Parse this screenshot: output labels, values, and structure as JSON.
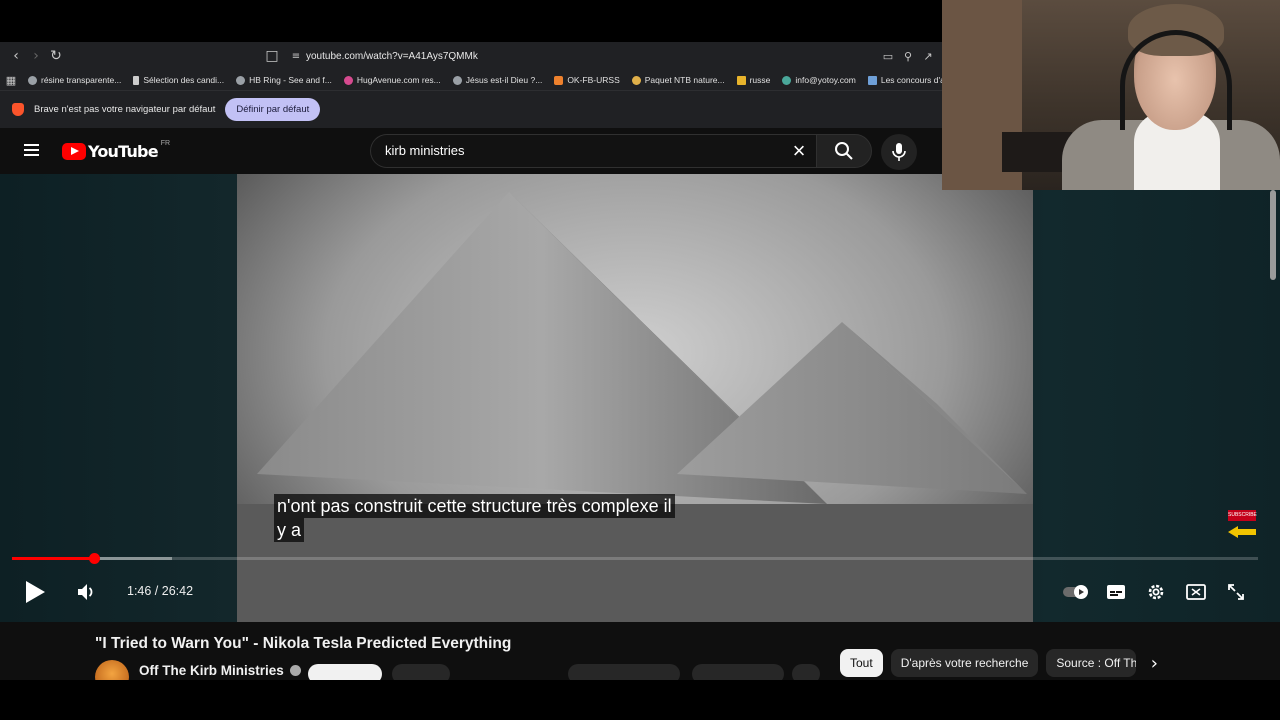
{
  "browser": {
    "url": "youtube.com/watch?v=A41Ays7QMMk",
    "bookmarks": [
      {
        "label": "résine transparente..."
      },
      {
        "label": "Sélection des candi..."
      },
      {
        "label": "HB Ring - See and f..."
      },
      {
        "label": "HugAvenue.com res..."
      },
      {
        "label": "Jésus est-il Dieu ?..."
      },
      {
        "label": "OK-FB-URSS"
      },
      {
        "label": "Paquet NTB nature..."
      },
      {
        "label": "russe"
      },
      {
        "label": "info@yotoy.com"
      },
      {
        "label": "Les concours d'aute..."
      }
    ],
    "infobar": {
      "message": "Brave n'est pas votre navigateur par défaut",
      "button": "Définir par défaut"
    }
  },
  "youtube": {
    "logo_text": "YouTube",
    "region": "FR",
    "search": {
      "value": "kirb ministries"
    }
  },
  "player": {
    "subtitle_line1": "n'ont pas construit cette structure très complexe il",
    "subtitle_line2": "y a",
    "current_time": "1:46",
    "duration": "26:42",
    "time_display": "1:46 / 26:42",
    "progress_fraction": 0.066,
    "subscribe_badge": "SUBSCRIBE"
  },
  "video": {
    "title": "\"I Tried to Warn You\" - Nikola Tesla Predicted Everything",
    "channel": "Off The Kirb Ministries"
  },
  "chips": [
    {
      "label": "Tout",
      "active": true
    },
    {
      "label": "D'après votre recherche",
      "active": false
    },
    {
      "label": "Source : Off The Kirb Ministries",
      "active": false
    }
  ],
  "colors": {
    "accent": "#ff0000",
    "infobar_button": "#c2c1f5"
  }
}
